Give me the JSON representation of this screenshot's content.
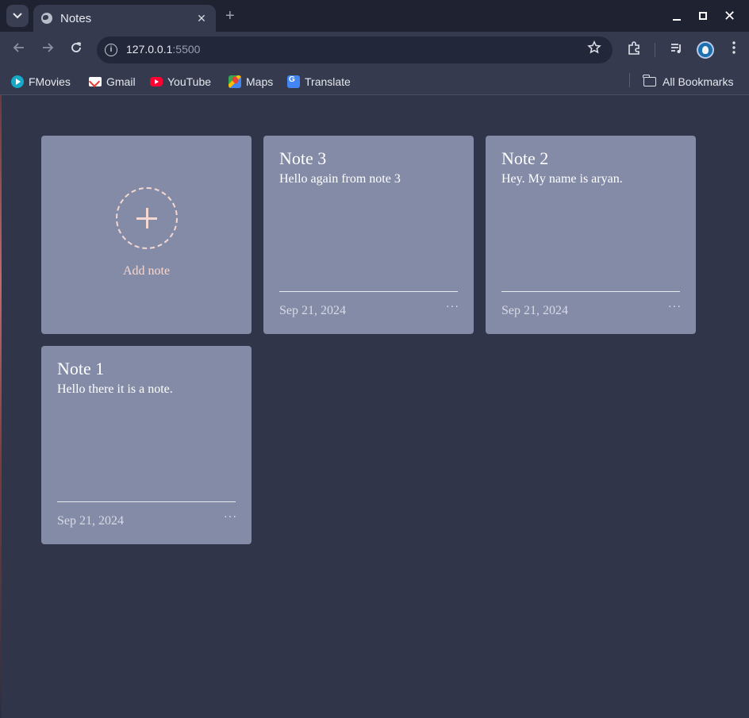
{
  "browser": {
    "tab": {
      "title": "Notes",
      "close": "✕"
    },
    "new_tab": "+",
    "window_close": "✕",
    "url": {
      "host": "127.0.0.1",
      "port": ":5500"
    },
    "bookmarks": [
      {
        "label": "FMovies"
      },
      {
        "label": "Gmail"
      },
      {
        "label": "YouTube"
      },
      {
        "label": "Maps"
      },
      {
        "label": "Translate"
      }
    ],
    "all_bookmarks": "All Bookmarks"
  },
  "app": {
    "add_note_label": "Add note",
    "notes": [
      {
        "title": "Note 3",
        "body": "Hello again from note 3",
        "date": "Sep 21, 2024"
      },
      {
        "title": "Note 2",
        "body": "Hey. My name is aryan.",
        "date": "Sep 21, 2024"
      },
      {
        "title": "Note 1",
        "body": "Hello there it is a note.",
        "date": "Sep 21, 2024"
      }
    ],
    "menu_glyph": "···"
  },
  "colors": {
    "page_bg": "#31354a",
    "card_bg": "#848ba6",
    "accent": "#f5d7d2"
  }
}
